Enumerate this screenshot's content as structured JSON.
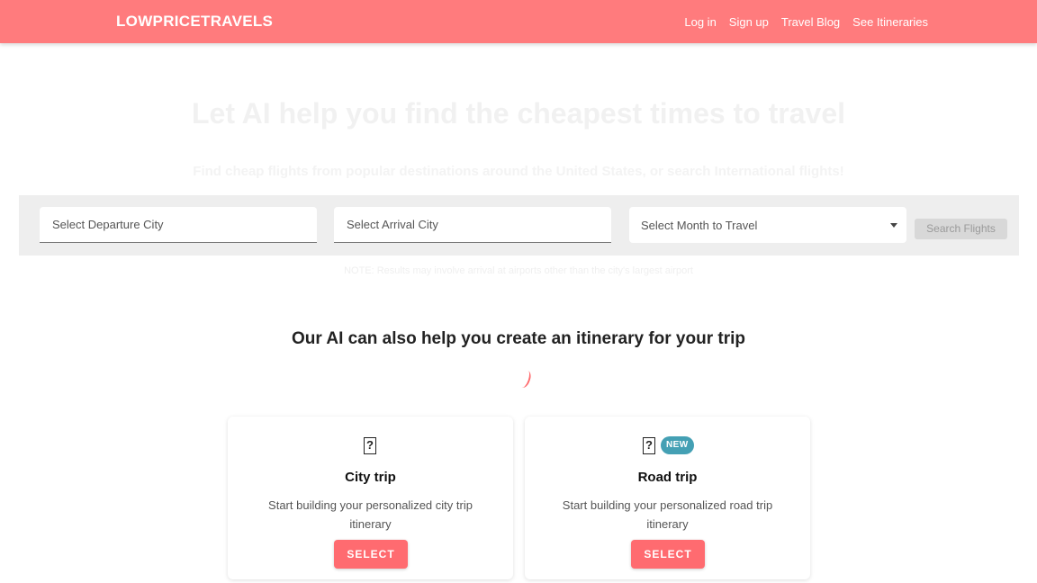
{
  "header": {
    "brand": "LOWPRICETRAVELS",
    "links": [
      "Log in",
      "Sign up",
      "Travel Blog",
      "See Itineraries"
    ]
  },
  "hero": {
    "title": "Let AI help you find the cheapest times to travel",
    "subtitle": "Find cheap flights from popular destinations around the United States, or search International flights!"
  },
  "search": {
    "departure_placeholder": "Select Departure City",
    "arrival_placeholder": "Select Arrival City",
    "month_label": "Select Month to Travel",
    "button_label": "Search Flights"
  },
  "note": "NOTE: Results may involve arrival at airports other than the city's largest airport",
  "itinerary": {
    "heading": "Our AI can also help you create an itinerary for your trip",
    "cards": [
      {
        "icon": "question-box-icon",
        "title": "City trip",
        "description": "Start building your personalized city trip itinerary",
        "button": "SELECT"
      },
      {
        "icon": "question-box-icon",
        "badge": "NEW",
        "title": "Road trip",
        "description": "Start building your personalized road trip itinerary",
        "button": "SELECT"
      }
    ]
  },
  "colors": {
    "brand": "#ff7b7d",
    "accent": "#ff6b70",
    "badge": "#44a0b4"
  }
}
